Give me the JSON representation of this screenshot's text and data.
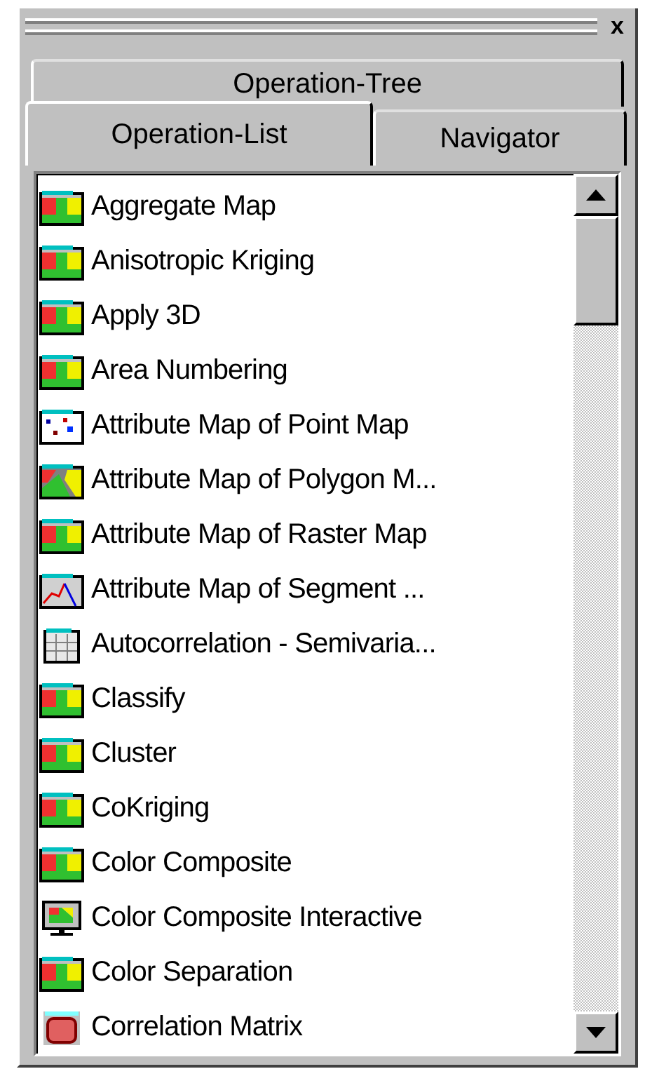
{
  "panel": {
    "close": "x"
  },
  "tabs_back": [
    {
      "label": "Operation-Tree",
      "selected": false
    }
  ],
  "tabs_front": [
    {
      "label": "Operation-List",
      "selected": true
    },
    {
      "label": "Navigator",
      "selected": false
    }
  ],
  "operations": [
    {
      "label": "Aggregate Map",
      "kind": "raster"
    },
    {
      "label": "Anisotropic Kriging",
      "kind": "raster"
    },
    {
      "label": "Apply 3D",
      "kind": "raster"
    },
    {
      "label": "Area Numbering",
      "kind": "raster"
    },
    {
      "label": "Attribute Map of Point Map",
      "kind": "point"
    },
    {
      "label": "Attribute Map of Polygon M...",
      "kind": "polygon"
    },
    {
      "label": "Attribute Map of Raster Map",
      "kind": "raster"
    },
    {
      "label": "Attribute Map of Segment ...",
      "kind": "segment"
    },
    {
      "label": "Autocorrelation - Semivaria...",
      "kind": "table"
    },
    {
      "label": "Classify",
      "kind": "raster"
    },
    {
      "label": "Cluster",
      "kind": "raster"
    },
    {
      "label": "CoKriging",
      "kind": "raster"
    },
    {
      "label": "Color Composite",
      "kind": "raster"
    },
    {
      "label": "Color Composite Interactive",
      "kind": "monitor"
    },
    {
      "label": "Color Separation",
      "kind": "raster"
    },
    {
      "label": "Correlation Matrix",
      "kind": "matrix"
    }
  ]
}
